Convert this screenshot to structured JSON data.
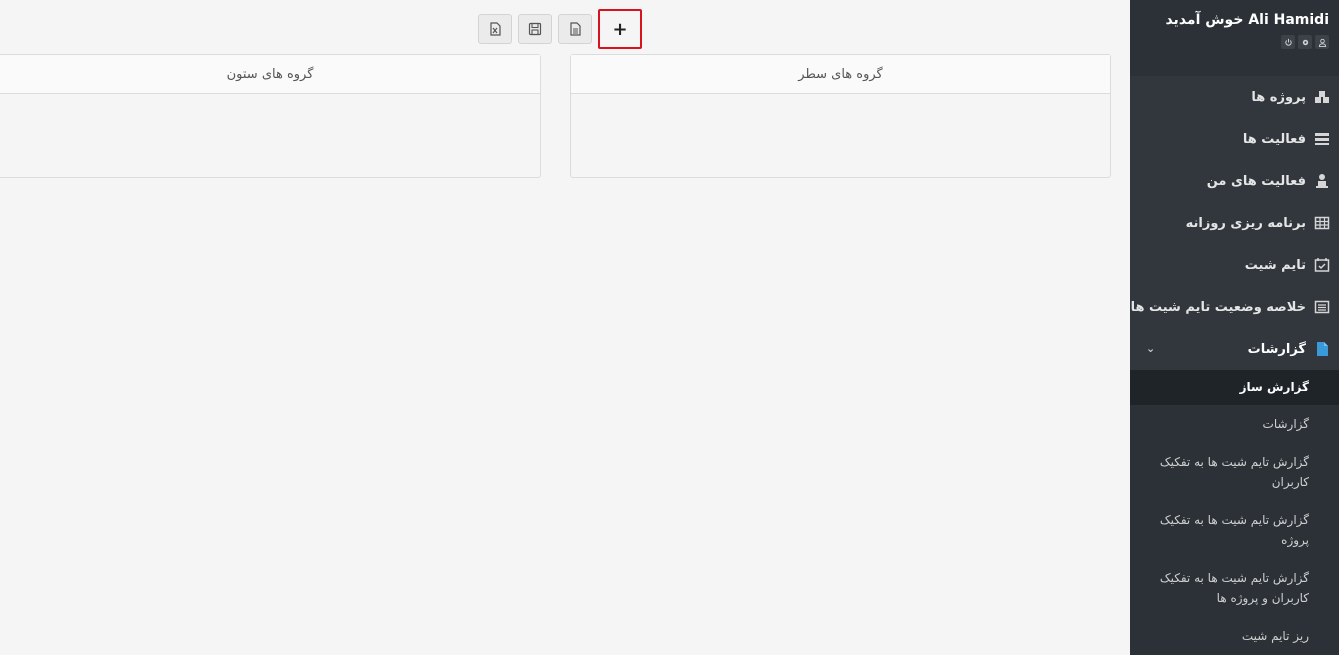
{
  "toolbar": {
    "buttons": [
      {
        "name": "excel-export-button",
        "icon": "excel-file-icon"
      },
      {
        "name": "save-button",
        "icon": "floppy-disk-icon"
      },
      {
        "name": "document-button",
        "icon": "document-icon"
      },
      {
        "name": "add-button",
        "icon": "plus-icon",
        "label": "+"
      }
    ]
  },
  "panels": {
    "row_groups_title": "گروه های سطر",
    "column_groups_title": "گروه های ستون"
  },
  "sidebar": {
    "welcome": "Ali Hamidi خوش آمدید",
    "head_icons": [
      "power-icon",
      "gear-icon",
      "user-icon"
    ],
    "menu": [
      {
        "label": "پروژه ها",
        "icon": "cubes-icon"
      },
      {
        "label": "فعالیت ها",
        "icon": "tasks-icon"
      },
      {
        "label": "فعالیت های من",
        "icon": "user-tasks-icon"
      },
      {
        "label": "برنامه ریزی روزانه",
        "icon": "table-icon"
      },
      {
        "label": "تایم شیت",
        "icon": "calendar-check-icon"
      },
      {
        "label": "خلاصه وضعیت تایم شیت ها",
        "icon": "list-icon"
      },
      {
        "label": "گزارشات",
        "icon": "file-icon"
      }
    ],
    "submenu": [
      {
        "label": "گزارش ساز"
      },
      {
        "label": "گزارشات"
      },
      {
        "label": "گزارش تایم شیت ها به تفکیک کاربران"
      },
      {
        "label": "گزارش تایم شیت ها به تفکیک پروژه"
      },
      {
        "label": "گزارش تایم شیت ها به تفکیک کاربران و پروژه ها"
      },
      {
        "label": "ریز تایم شیت"
      }
    ],
    "accent_color": "#3a9ad9"
  }
}
